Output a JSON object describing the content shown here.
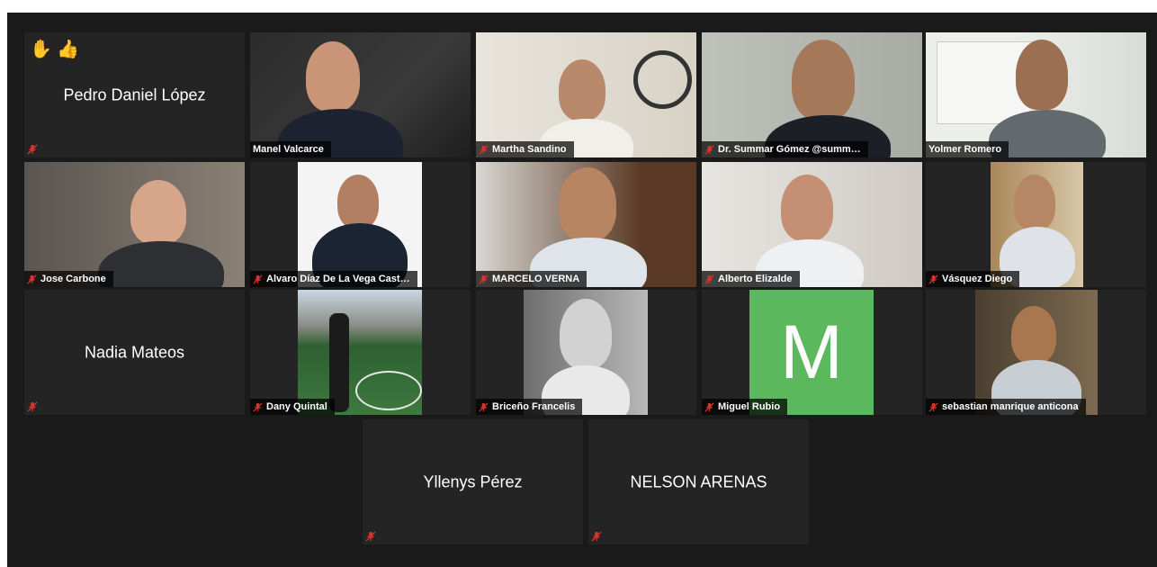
{
  "colors": {
    "background": "#1a1a1a",
    "tile": "#242424",
    "active_border": "#d6e07a",
    "mic_muted": "#d9342b",
    "avatar_bg": "#5cb85c"
  },
  "reactions": [
    "raised-hand",
    "thumbs-up"
  ],
  "participants": [
    {
      "name": "Pedro Daniel López",
      "video": false
    },
    {
      "name": "Manel Valcarce",
      "video": true
    },
    {
      "name": "Martha Sandino",
      "video": true
    },
    {
      "name": "Dr. Summar Gómez @summ…",
      "video": true
    },
    {
      "name": "Yolmer Romero",
      "video": true,
      "active_speaker": true
    },
    {
      "name": "Jose Carbone",
      "video": true
    },
    {
      "name": "Alvaro Díaz De La Vega Cast…",
      "video": true
    },
    {
      "name": "MARCELO VERNA",
      "video": true
    },
    {
      "name": "Alberto Elizalde",
      "video": true
    },
    {
      "name": "Vásquez Diego",
      "video": true
    },
    {
      "name": "Nadia Mateos",
      "video": false
    },
    {
      "name": "Dany Quintal",
      "video": true
    },
    {
      "name": "Briceño Francelis",
      "video": true
    },
    {
      "name": "Miguel Rubio",
      "video": false,
      "avatar_letter": "M"
    },
    {
      "name": "sebastian manrique anticona",
      "video": true
    },
    {
      "name": "Yllenys Pérez",
      "video": false
    },
    {
      "name": "NELSON ARENAS",
      "video": false
    }
  ]
}
